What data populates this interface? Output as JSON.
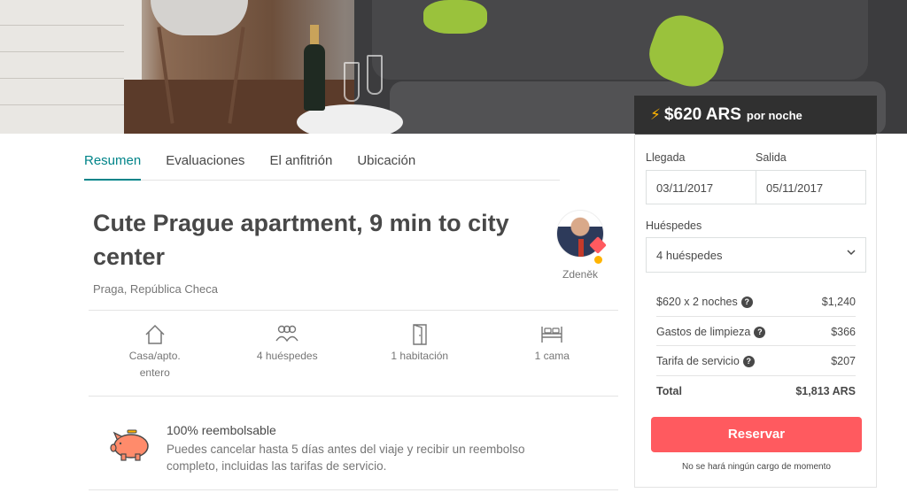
{
  "price": {
    "amount": "$620 ARS",
    "per": "por noche"
  },
  "tabs": [
    "Resumen",
    "Evaluaciones",
    "El anfitrión",
    "Ubicación"
  ],
  "listing": {
    "title": "Cute Prague apartment, 9 min to city center",
    "location": "Praga, República Checa",
    "host_name": "Zdeněk"
  },
  "features": [
    {
      "icon": "house-icon",
      "label": "Casa/apto. entero"
    },
    {
      "icon": "guests-icon",
      "label": "4 huéspedes"
    },
    {
      "icon": "door-icon",
      "label": "1 habitación"
    },
    {
      "icon": "bed-icon",
      "label": "1 cama"
    }
  ],
  "refund": {
    "title": "100% reembolsable",
    "text": "Puedes cancelar hasta 5 días antes del viaje y recibir un reembolso completo, incluidas las tarifas de servicio."
  },
  "booking": {
    "checkin_label": "Llegada",
    "checkout_label": "Salida",
    "checkin": "03/11/2017",
    "checkout": "05/11/2017",
    "guests_label": "Huéspedes",
    "guests": "4 huéspedes",
    "rows": [
      {
        "label": "$620 x 2 noches",
        "value": "$1,240"
      },
      {
        "label": "Gastos de limpieza",
        "value": "$366"
      },
      {
        "label": "Tarifa de servicio",
        "value": "$207"
      }
    ],
    "total_label": "Total",
    "total_value": "$1,813 ARS",
    "reserve_label": "Reservar",
    "note": "No se hará ningún cargo de momento"
  },
  "colors": {
    "accent": "#008489",
    "brand": "#ff5a5f",
    "bolt": "#ffb400"
  }
}
